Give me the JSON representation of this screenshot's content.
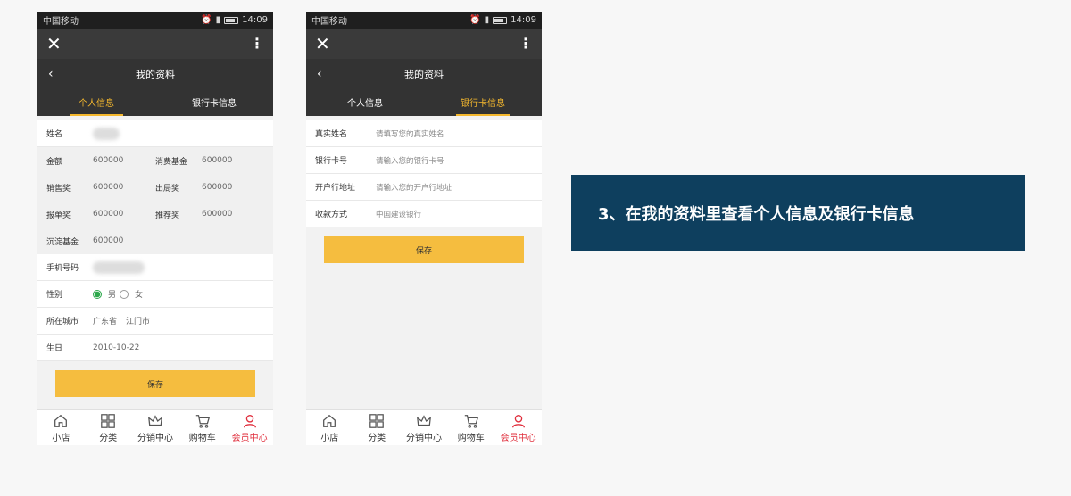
{
  "status": {
    "carrier": "中国移动",
    "time": "14:09"
  },
  "nav": {
    "title": "我的资料"
  },
  "tabs": [
    "个人信息",
    "银行卡信息"
  ],
  "personal": {
    "name_label": "姓名",
    "pairs": [
      {
        "l1": "金额",
        "v1": "600000",
        "l2": "消费基金",
        "v2": "600000"
      },
      {
        "l1": "销售奖",
        "v1": "600000",
        "l2": "出局奖",
        "v2": "600000"
      },
      {
        "l1": "报单奖",
        "v1": "600000",
        "l2": "推荐奖",
        "v2": "600000"
      }
    ],
    "settle_label": "沉淀基金",
    "settle_value": "600000",
    "phone_label": "手机号码",
    "gender_label": "性别",
    "gender_male": "男",
    "gender_female": "女",
    "city_label": "所在城市",
    "province": "广东省",
    "city": "江门市",
    "birth_label": "生日",
    "birth_value": "2010-10-22"
  },
  "bank": {
    "rows": [
      {
        "label": "真实姓名",
        "placeholder": "请填写您的真实姓名"
      },
      {
        "label": "银行卡号",
        "placeholder": "请输入您的银行卡号"
      },
      {
        "label": "开户行地址",
        "placeholder": "请输入您的开户行地址"
      },
      {
        "label": "收款方式",
        "placeholder": "中国建设银行"
      }
    ]
  },
  "save_label": "保存",
  "tabbar": [
    "小店",
    "分类",
    "分销中心",
    "购物车",
    "会员中心"
  ],
  "banner": "3、在我的资料里查看个人信息及银行卡信息",
  "colors": {
    "accent": "#f5b82e",
    "save": "#f5bd3f",
    "active_tab": "#e0303e",
    "banner_bg": "#0e3f5e"
  }
}
